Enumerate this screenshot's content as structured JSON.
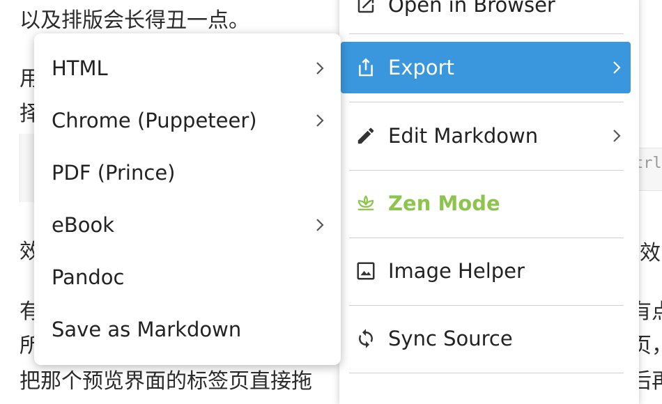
{
  "document": {
    "line1": "以及排版会长得丑一点。",
    "frag_left_1": "用",
    "frag_left_2": "择",
    "frag_left_3": "效",
    "frag_left_4": "有",
    "frag_left_5": "所",
    "line_bottom": "把那个预览界面的标签页直接拖",
    "frag_right_1": "效",
    "frag_right_2": "有点",
    "frag_right_3": "页，",
    "frag_right_4": "后再",
    "code_snippet": "trl+"
  },
  "main_menu": {
    "items": [
      {
        "label": "Open in Browser",
        "icon": "open-external-icon",
        "has_submenu": false
      },
      {
        "label": "Export",
        "icon": "share-export-icon",
        "has_submenu": true,
        "active": true
      },
      {
        "label": "Edit Markdown",
        "icon": "pencil-icon",
        "has_submenu": true
      },
      {
        "label": "Zen Mode",
        "icon": "lotus-icon",
        "has_submenu": false,
        "color": "#8dc44d"
      },
      {
        "label": "Image Helper",
        "icon": "image-icon",
        "has_submenu": false
      },
      {
        "label": "Sync Source",
        "icon": "sync-icon",
        "has_submenu": false
      }
    ],
    "active_color": "#3a97dd"
  },
  "export_submenu": {
    "items": [
      {
        "label": "HTML",
        "has_submenu": true
      },
      {
        "label": "Chrome (Puppeteer)",
        "has_submenu": true
      },
      {
        "label": "PDF (Prince)",
        "has_submenu": false
      },
      {
        "label": "eBook",
        "has_submenu": true
      },
      {
        "label": "Pandoc",
        "has_submenu": false
      },
      {
        "label": "Save as Markdown",
        "has_submenu": false
      }
    ]
  }
}
